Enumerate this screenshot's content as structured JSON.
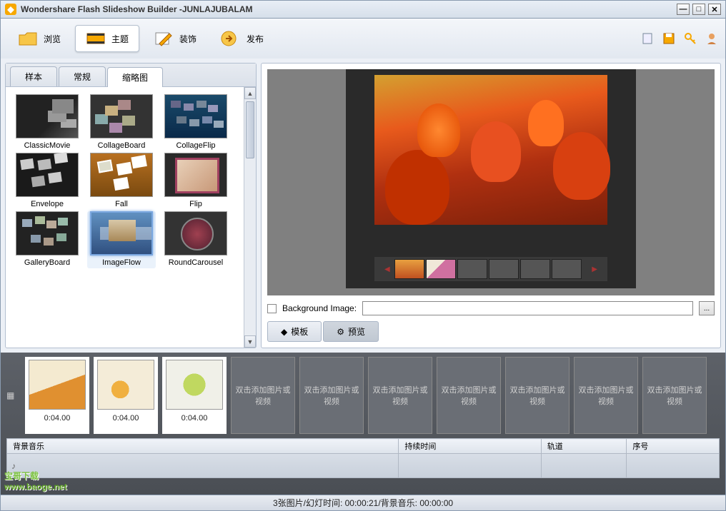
{
  "window": {
    "title": "Wondershare Flash Slideshow Builder -JUNLAJUBALAM"
  },
  "toolbar": {
    "browse": "浏览",
    "theme": "主题",
    "decorate": "装饰",
    "publish": "发布"
  },
  "theme_tabs": {
    "sample": "样本",
    "normal": "常规",
    "thumbnail": "缩略图"
  },
  "themes": [
    {
      "label": "ClassicMovie",
      "cls": "th-movie"
    },
    {
      "label": "CollageBoard",
      "cls": "th-collage"
    },
    {
      "label": "CollageFlip",
      "cls": "th-collageflip"
    },
    {
      "label": "Envelope",
      "cls": "th-env"
    },
    {
      "label": "Fall",
      "cls": "th-fall"
    },
    {
      "label": "Flip",
      "cls": "th-flip"
    },
    {
      "label": "GalleryBoard",
      "cls": "th-gallery"
    },
    {
      "label": "ImageFlow",
      "cls": "th-imageflow",
      "selected": true
    },
    {
      "label": "RoundCarousel",
      "cls": "th-carousel"
    }
  ],
  "bg_image": {
    "label": "Background Image:",
    "value": "",
    "browse": "..."
  },
  "bottom_tabs": {
    "template": "模板",
    "preview": "预览"
  },
  "timeline": {
    "clips": [
      {
        "time": "0:04.00",
        "cls": "clip-i1"
      },
      {
        "time": "0:04.00",
        "cls": "clip-i2"
      },
      {
        "time": "0:04.00",
        "cls": "clip-i3"
      }
    ],
    "empty_text": "双击添加图片或视频",
    "empty_count": 7,
    "columns": {
      "bgm": "背景音乐",
      "duration": "持续时间",
      "track": "轨道",
      "index": "序号"
    }
  },
  "status": "3张图片/幻灯时间: 00:00:21/背景音乐: 00:00:00",
  "watermark": {
    "text": "宝哥下载",
    "url": "www.baoge.net"
  }
}
